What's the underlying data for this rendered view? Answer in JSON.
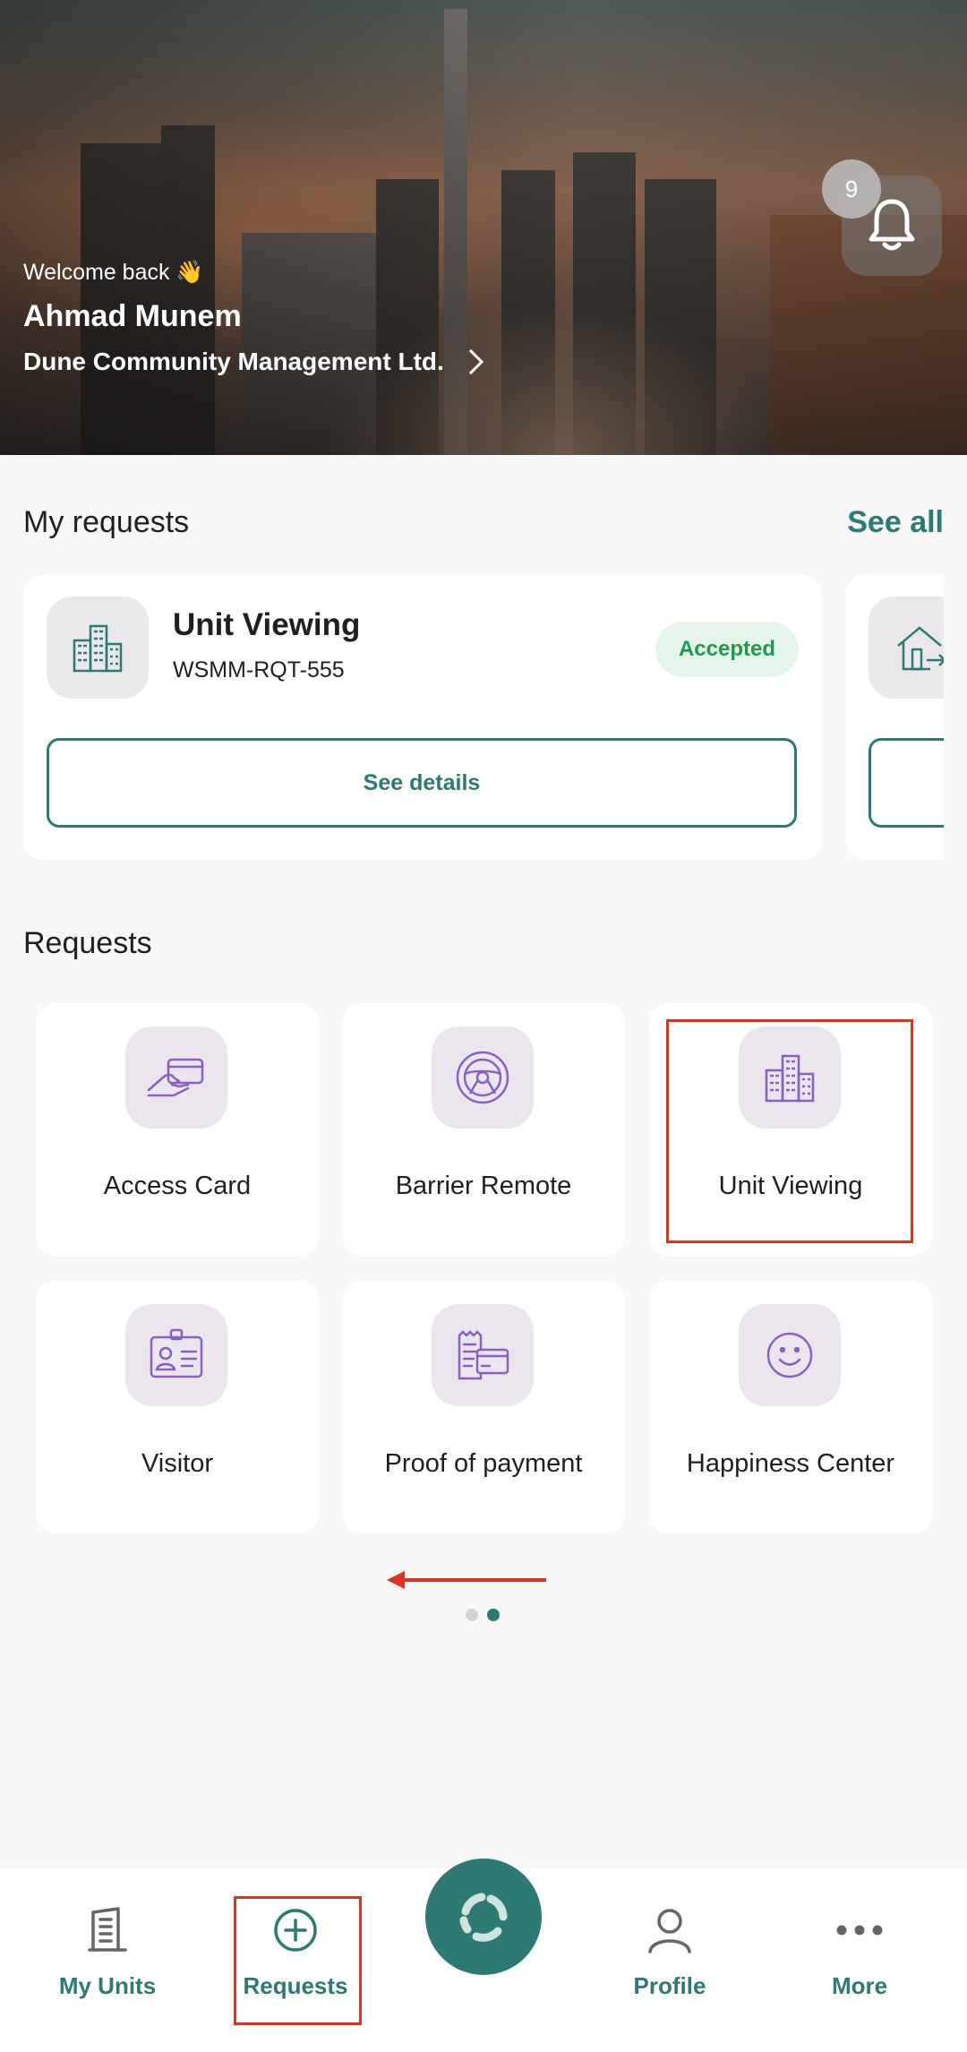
{
  "header": {
    "welcome_text": "Welcome back 👋",
    "user_name": "Ahmad Munem",
    "community_name": "Dune Community Management Ltd.",
    "notification_count": "9"
  },
  "my_requests": {
    "title": "My requests",
    "see_all_label": "See all",
    "card": {
      "title": "Unit Viewing",
      "code": "WSMM-RQT-555",
      "status": "Accepted",
      "button_label": "See details"
    }
  },
  "requests": {
    "title": "Requests",
    "items": [
      {
        "label": "Access Card",
        "icon": "access-card-icon"
      },
      {
        "label": "Barrier Remote",
        "icon": "barrier-remote-icon"
      },
      {
        "label": "Unit Viewing",
        "icon": "buildings-icon"
      },
      {
        "label": "Visitor",
        "icon": "visitor-badge-icon"
      },
      {
        "label": "Proof of payment",
        "icon": "receipt-card-icon"
      },
      {
        "label": "Happiness Center",
        "icon": "smiley-icon"
      }
    ],
    "page_count": 2,
    "active_page": 2
  },
  "bottom_nav": {
    "items": [
      {
        "label": "My Units",
        "icon": "building-icon"
      },
      {
        "label": "Requests",
        "icon": "plus-circle-icon"
      },
      {
        "label": "Profile",
        "icon": "person-icon"
      },
      {
        "label": "More",
        "icon": "more-dots-icon"
      }
    ],
    "center_icon": "app-logo-icon"
  },
  "colors": {
    "accent": "#2c7a73",
    "status_green": "#1e9a4c",
    "highlight_red": "#e0331f",
    "icon_purple": "#8a5fc0"
  }
}
